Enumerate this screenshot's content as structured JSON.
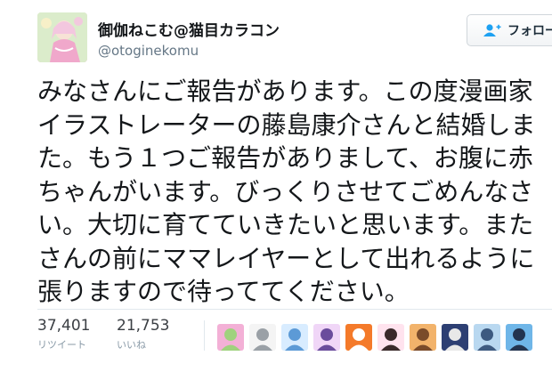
{
  "author": {
    "display_name": "御伽ねこむ@猫目カラコン",
    "handle": "@otoginekomu"
  },
  "follow_button": {
    "label": "フォロー",
    "icon": "add-user-icon"
  },
  "tweet": {
    "lines": [
      "みなさんにご報告があります。この度漫画家",
      "イラストレーターの藤島康介さんと結婚しま",
      "た。もう１つご報告がありまして、お腹に赤",
      "ちゃんがいます。びっくりさせてごめんなさ",
      "い。大切に育てていきたいと思います。また",
      "さんの前にママレイヤーとして出れるように",
      "張りますので待っててください。"
    ]
  },
  "stats": {
    "retweets": {
      "count": "37,401",
      "label": "リツイート"
    },
    "likes": {
      "count": "21,753",
      "label": "いいね"
    }
  },
  "liked_by": [
    {
      "name": "liker-1",
      "colors": [
        "#f3b0d6",
        "#9fd27d"
      ]
    },
    {
      "name": "liker-2",
      "colors": [
        "#f4f4f4",
        "#9aa0a6"
      ]
    },
    {
      "name": "liker-3",
      "colors": [
        "#d8ecff",
        "#5c9ad6"
      ]
    },
    {
      "name": "liker-4",
      "colors": [
        "#f0d6f7",
        "#6a4c9c"
      ]
    },
    {
      "name": "liker-5",
      "colors": [
        "#f47a2a",
        "#ffffff"
      ]
    },
    {
      "name": "liker-6",
      "colors": [
        "#ffe3ee",
        "#3a2a2a"
      ]
    },
    {
      "name": "liker-7",
      "colors": [
        "#f2b36b",
        "#7a4b2a"
      ]
    },
    {
      "name": "liker-8",
      "colors": [
        "#2d3f73",
        "#e8e8e8"
      ]
    },
    {
      "name": "liker-9",
      "colors": [
        "#b9d8f0",
        "#3d5a80"
      ]
    },
    {
      "name": "liker-10",
      "colors": [
        "#6fb6e8",
        "#23344f"
      ]
    }
  ]
}
